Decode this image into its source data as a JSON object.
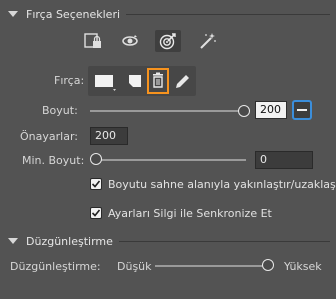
{
  "sections": {
    "brush_options": {
      "title": "Fırça Seçenekleri"
    },
    "smoothing": {
      "title": "Düzgünleştirme"
    }
  },
  "toolbar": {
    "icons": [
      "lock-canvas-icon",
      "rotate-sync-icon",
      "target-brush-icon",
      "magic-wand-icon"
    ],
    "active_index": 2
  },
  "brush": {
    "label": "Fırça:",
    "icons": [
      "brush-shape-icon",
      "brush-shape-alt-icon",
      "trash-icon",
      "pencil-icon"
    ]
  },
  "size": {
    "label": "Boyut:",
    "value": "200",
    "slider_level_percent": 100
  },
  "presets": {
    "label": "Önayarlar:",
    "value": "200"
  },
  "min_size": {
    "label": "Min. Boyut:",
    "value": "0",
    "slider_level_percent": 0
  },
  "options": {
    "zoom_with_stage": {
      "label": "Boyutu sahne alanıyla yakınlaştır/uzaklaştır",
      "checked": true
    },
    "sync_eraser": {
      "label": "Ayarları Silgi ile Senkronize Et",
      "checked": true
    }
  },
  "smoothing": {
    "label": "Düzgünleştirme:",
    "low_label": "Düşük",
    "high_label": "Yüksek",
    "slider_level_percent": 100
  },
  "colors": {
    "panel_bg": "#535353",
    "highlight": "#f7931e",
    "accent_blue": "#3b8edb"
  }
}
